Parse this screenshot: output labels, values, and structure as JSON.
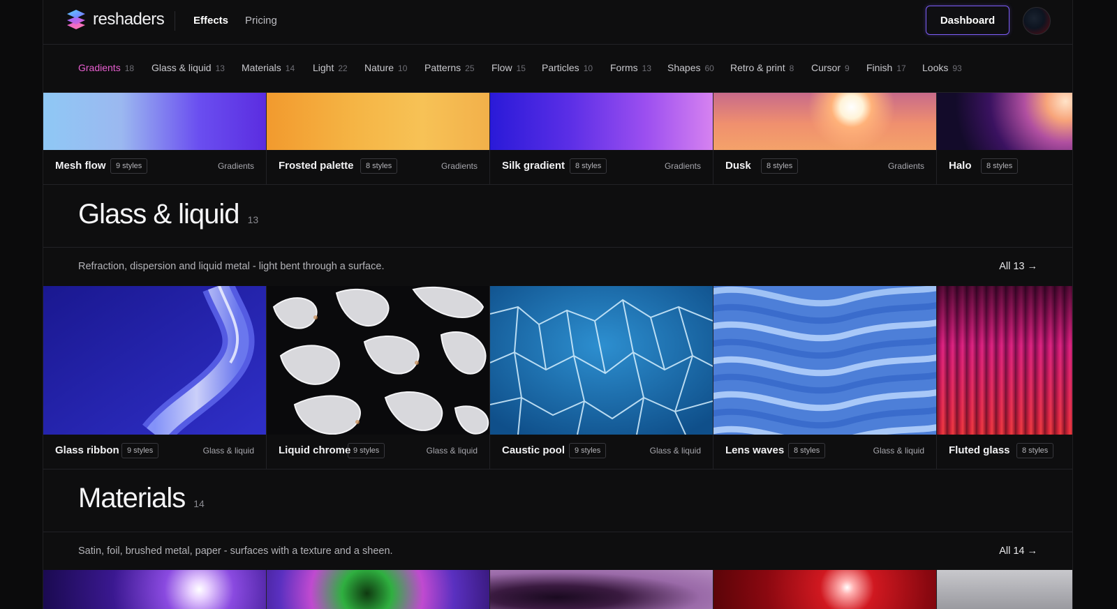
{
  "header": {
    "brand": "reshaders",
    "nav": {
      "effects": "Effects",
      "pricing": "Pricing"
    },
    "dashboard_label": "Dashboard"
  },
  "categories": [
    {
      "label": "Gradients",
      "count": "18",
      "active": true
    },
    {
      "label": "Glass & liquid",
      "count": "13"
    },
    {
      "label": "Materials",
      "count": "14"
    },
    {
      "label": "Light",
      "count": "22"
    },
    {
      "label": "Nature",
      "count": "10"
    },
    {
      "label": "Patterns",
      "count": "25"
    },
    {
      "label": "Flow",
      "count": "15"
    },
    {
      "label": "Particles",
      "count": "10"
    },
    {
      "label": "Forms",
      "count": "13"
    },
    {
      "label": "Shapes",
      "count": "60"
    },
    {
      "label": "Retro & print",
      "count": "8"
    },
    {
      "label": "Cursor",
      "count": "9"
    },
    {
      "label": "Finish",
      "count": "17"
    },
    {
      "label": "Looks",
      "count": "93"
    }
  ],
  "gradients_row": [
    {
      "name": "Mesh flow",
      "styles": "9 styles",
      "tag": "Gradients"
    },
    {
      "name": "Frosted palette",
      "styles": "8 styles",
      "tag": "Gradients"
    },
    {
      "name": "Silk gradient",
      "styles": "8 styles",
      "tag": "Gradients"
    },
    {
      "name": "Dusk",
      "styles": "8 styles",
      "tag": "Gradients"
    },
    {
      "name": "Halo",
      "styles": "8 styles",
      "tag": ""
    }
  ],
  "glass_section": {
    "title": "Glass & liquid",
    "count": "13",
    "description": "Refraction, dispersion and liquid metal - light bent through a surface.",
    "all_link": "All 13 →",
    "cards": [
      {
        "name": "Glass ribbon",
        "styles": "9 styles",
        "tag": "Glass & liquid"
      },
      {
        "name": "Liquid chrome",
        "styles": "9 styles",
        "tag": "Glass & liquid"
      },
      {
        "name": "Caustic pool",
        "styles": "9 styles",
        "tag": "Glass & liquid"
      },
      {
        "name": "Lens waves",
        "styles": "8 styles",
        "tag": "Glass & liquid"
      },
      {
        "name": "Fluted glass",
        "styles": "8 styles",
        "tag": ""
      }
    ]
  },
  "materials_section": {
    "title": "Materials",
    "count": "14",
    "description": "Satin, foil, brushed metal, paper - surfaces with a texture and a sheen.",
    "all_link": "All 14 →"
  },
  "colors": {
    "accent_active": "#e85fd0",
    "dashboard_border": "#7b5cf5",
    "background": "#0e0e0f"
  }
}
